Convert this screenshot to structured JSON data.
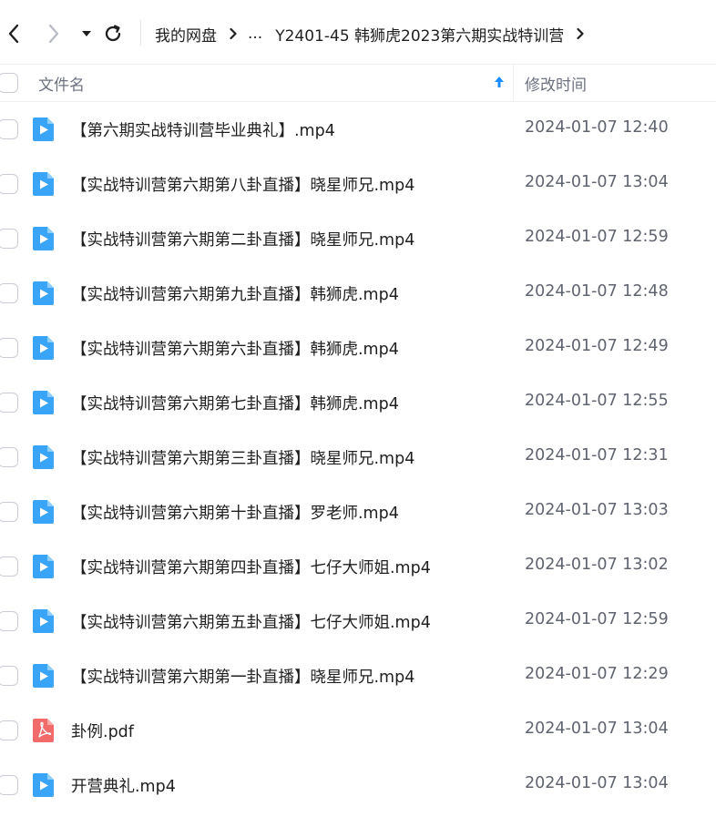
{
  "nav": {
    "back_icon": "chevron-left-icon",
    "forward_icon": "chevron-right-icon",
    "history_icon": "caret-down-icon",
    "refresh_icon": "refresh-icon"
  },
  "breadcrumb": {
    "root": "我的网盘",
    "ellipsis": "...",
    "current": "Y2401-45 韩狮虎2023第六期实战特训营",
    "separator_icon": "chevron-right-icon"
  },
  "table": {
    "header_name": "文件名",
    "header_time": "修改时间",
    "sort_icon": "arrow-up-icon"
  },
  "files": [
    {
      "name": "【第六期实战特训营毕业典礼】.mp4",
      "time": "2024-01-07 12:40",
      "type": "video"
    },
    {
      "name": "【实战特训营第六期第八卦直播】晓星师兄.mp4",
      "time": "2024-01-07 13:04",
      "type": "video"
    },
    {
      "name": "【实战特训营第六期第二卦直播】晓星师兄.mp4",
      "time": "2024-01-07 12:59",
      "type": "video"
    },
    {
      "name": "【实战特训营第六期第九卦直播】韩狮虎.mp4",
      "time": "2024-01-07 12:48",
      "type": "video"
    },
    {
      "name": "【实战特训营第六期第六卦直播】韩狮虎.mp4",
      "time": "2024-01-07 12:49",
      "type": "video"
    },
    {
      "name": "【实战特训营第六期第七卦直播】韩狮虎.mp4",
      "time": "2024-01-07 12:55",
      "type": "video"
    },
    {
      "name": "【实战特训营第六期第三卦直播】晓星师兄.mp4",
      "time": "2024-01-07 12:31",
      "type": "video"
    },
    {
      "name": "【实战特训营第六期第十卦直播】罗老师.mp4",
      "time": "2024-01-07 13:03",
      "type": "video"
    },
    {
      "name": "【实战特训营第六期第四卦直播】七仔大师姐.mp4",
      "time": "2024-01-07 13:02",
      "type": "video"
    },
    {
      "name": "【实战特训营第六期第五卦直播】七仔大师姐.mp4",
      "time": "2024-01-07 12:59",
      "type": "video"
    },
    {
      "name": "【实战特训营第六期第一卦直播】晓星师兄.mp4",
      "time": "2024-01-07 12:29",
      "type": "video"
    },
    {
      "name": "卦例.pdf",
      "time": "2024-01-07 13:04",
      "type": "pdf"
    },
    {
      "name": "开营典礼.mp4",
      "time": "2024-01-07 13:04",
      "type": "video"
    }
  ],
  "colors": {
    "video_icon": "#3aa4f8",
    "pdf_icon": "#f26b6b",
    "sort_arrow": "#1a8cff",
    "text_primary": "#1f1f1f",
    "text_secondary": "#5f6470"
  }
}
